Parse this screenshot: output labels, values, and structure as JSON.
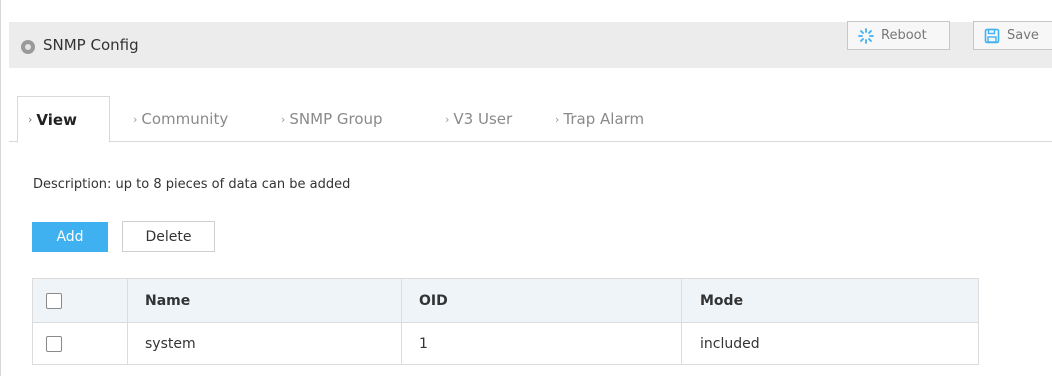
{
  "header": {
    "title": "SNMP Config",
    "reboot_label": "Reboot",
    "save_label": "Save"
  },
  "tabs": [
    {
      "label": "View",
      "active": true
    },
    {
      "label": "Community",
      "active": false
    },
    {
      "label": "SNMP Group",
      "active": false
    },
    {
      "label": "V3 User",
      "active": false
    },
    {
      "label": "Trap Alarm",
      "active": false
    }
  ],
  "description": "Description: up to 8 pieces of data can be added",
  "actions": {
    "add_label": "Add",
    "delete_label": "Delete"
  },
  "table": {
    "columns": [
      "Name",
      "OID",
      "Mode"
    ],
    "rows": [
      {
        "name": "system",
        "oid": "1",
        "mode": "included",
        "checked": false
      }
    ]
  },
  "colors": {
    "accent": "#3fb0f0",
    "header_bg": "#ececec",
    "table_head_bg": "#eef4f8"
  }
}
